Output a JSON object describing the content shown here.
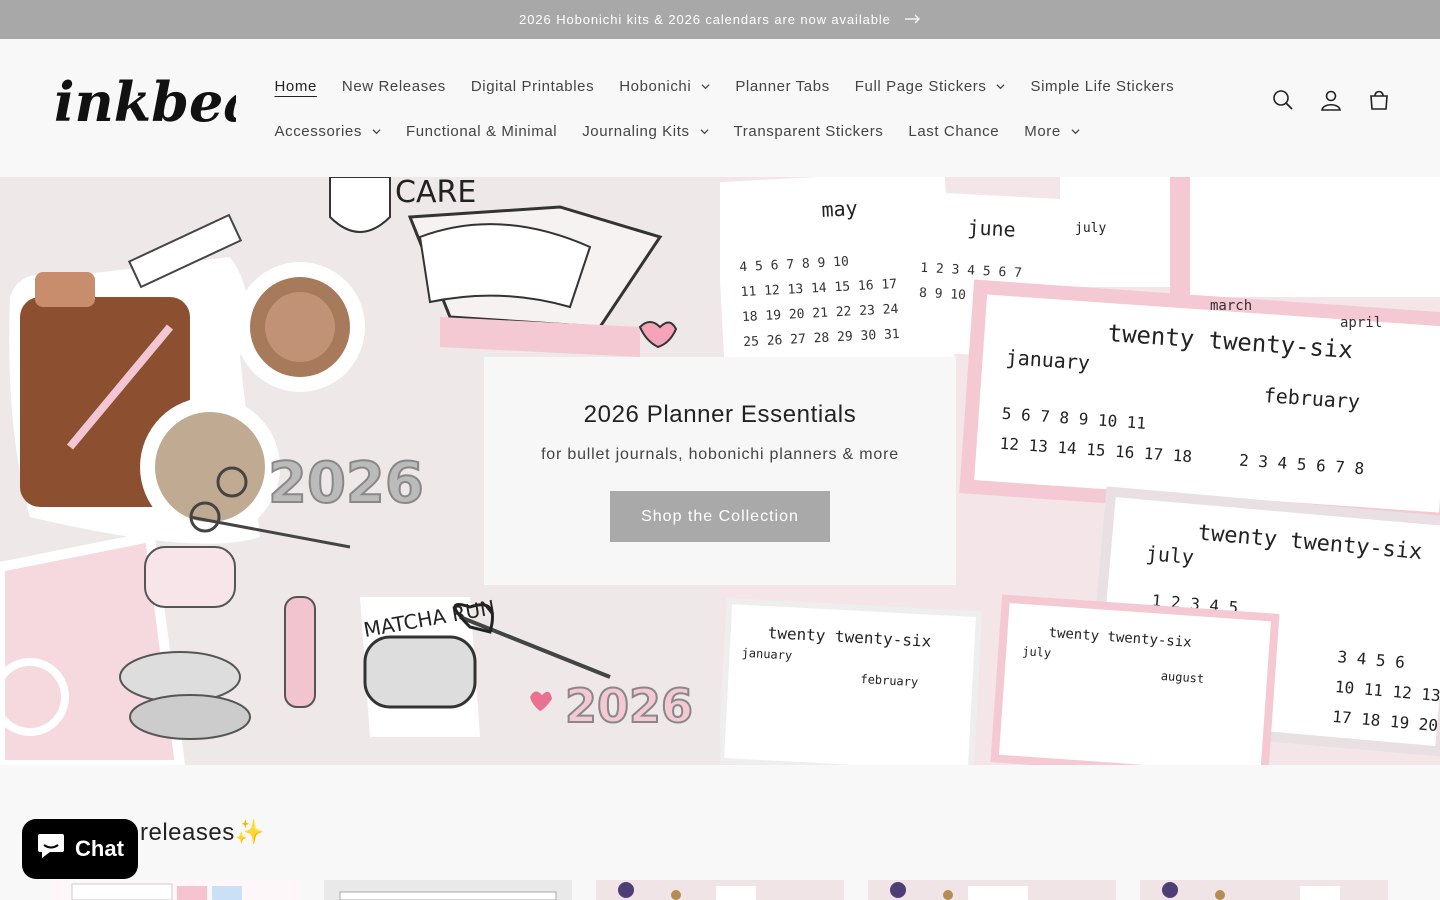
{
  "announcement": {
    "text": "2026 Hobonichi kits & 2026 calendars are now available",
    "arrow_icon": "arrow-right-icon"
  },
  "header": {
    "logo_text": "inkbea",
    "nav_row1": [
      {
        "label": "Home",
        "has_dropdown": false,
        "active": true
      },
      {
        "label": "New Releases",
        "has_dropdown": false
      },
      {
        "label": "Digital Printables",
        "has_dropdown": false
      },
      {
        "label": "Hobonichi",
        "has_dropdown": true
      },
      {
        "label": "Planner Tabs",
        "has_dropdown": false
      },
      {
        "label": "Full Page Stickers",
        "has_dropdown": true
      },
      {
        "label": "Simple Life Stickers",
        "has_dropdown": false
      }
    ],
    "nav_row2": [
      {
        "label": "Accessories",
        "has_dropdown": true
      },
      {
        "label": "Functional & Minimal",
        "has_dropdown": false
      },
      {
        "label": "Journaling Kits",
        "has_dropdown": true
      },
      {
        "label": "Transparent Stickers",
        "has_dropdown": false
      },
      {
        "label": "Last Chance",
        "has_dropdown": false
      },
      {
        "label": "More",
        "has_dropdown": true
      }
    ],
    "icons": [
      "search-icon",
      "account-icon",
      "cart-icon"
    ]
  },
  "hero": {
    "title": "2026 Planner Essentials",
    "subtitle": "for bullet journals, hobonichi planners & more",
    "button_label": "Shop the Collection",
    "left_sticker_text": [
      "CARE",
      "2026",
      "MATCHA RUN",
      "2026"
    ],
    "right_calendar_text": [
      "may",
      "june",
      "july",
      "twenty twenty-six",
      "january",
      "february",
      "march",
      "april",
      "august"
    ]
  },
  "new_releases": {
    "title": "releases",
    "sparkle": "✨"
  },
  "chat": {
    "label": "Chat"
  },
  "colors": {
    "announcement_bg": "#a8a8a8",
    "button_bg": "#a9a9a9",
    "chat_bg": "#000000",
    "accent_pink": "#f4c9d3"
  }
}
